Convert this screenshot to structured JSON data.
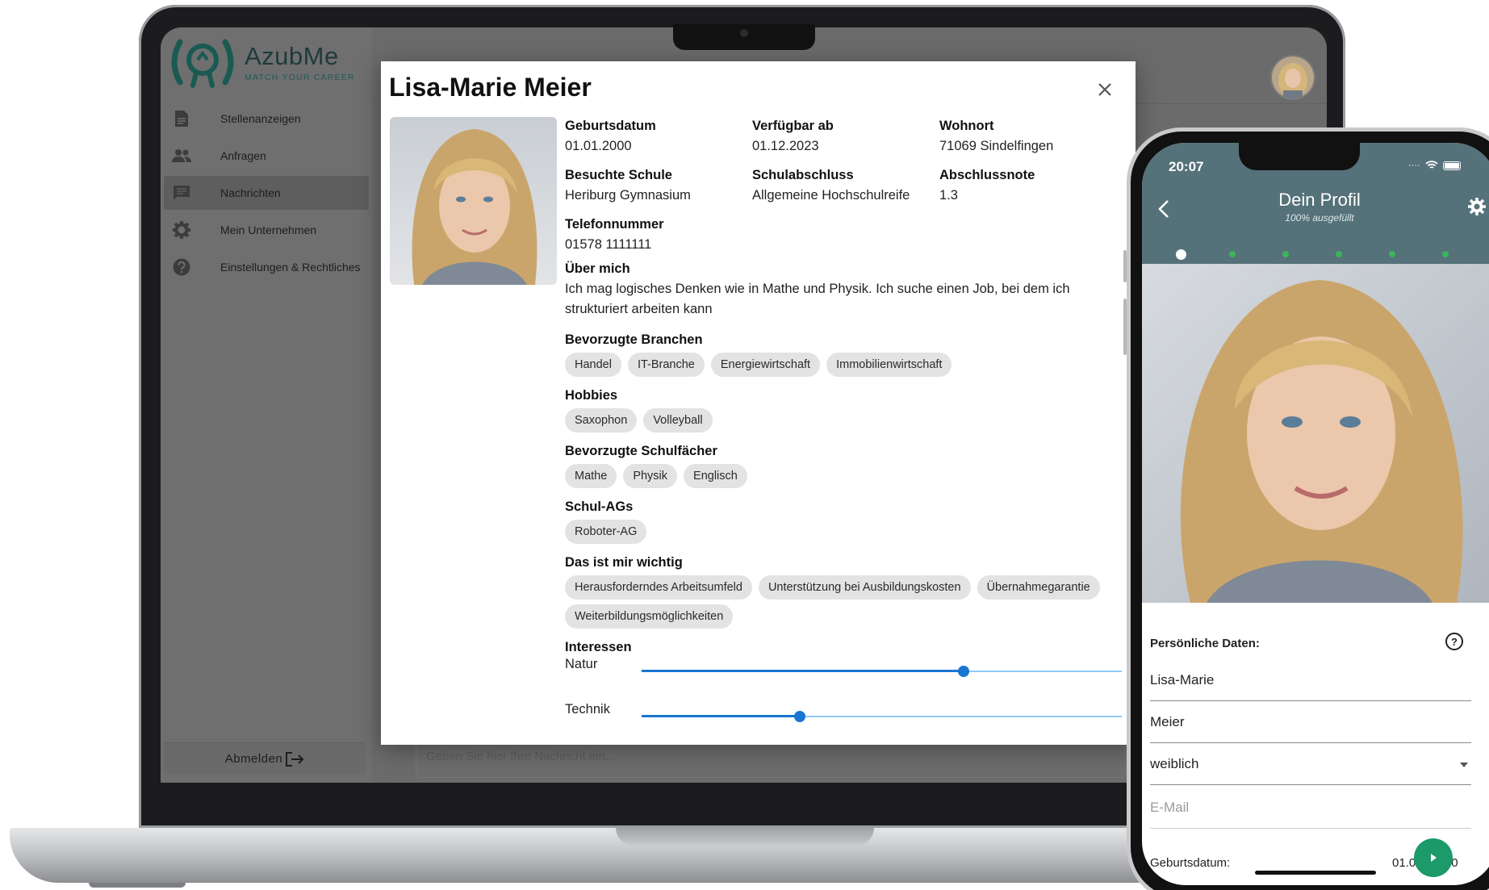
{
  "sidebar": {
    "logo_title": "AzubMe",
    "logo_subtitle": "MATCH YOUR CAREER",
    "items": [
      {
        "label": "Stellenanzeigen",
        "icon": "document-icon"
      },
      {
        "label": "Anfragen",
        "icon": "people-icon"
      },
      {
        "label": "Nachrichten",
        "icon": "chat-icon",
        "active": true
      },
      {
        "label": "Mein Unternehmen",
        "icon": "gear-icon"
      },
      {
        "label": "Einstellungen & Rechtliches",
        "icon": "help-icon"
      }
    ],
    "logout_label": "Abmelden"
  },
  "main": {
    "message_placeholder": "Geben Sie hier Ihre Nachricht ein..."
  },
  "modal": {
    "title": "Lisa-Marie Meier",
    "fields": [
      {
        "label": "Geburtsdatum",
        "value": "01.01.2000"
      },
      {
        "label": "Verfügbar ab",
        "value": "01.12.2023"
      },
      {
        "label": "Wohnort",
        "value": "71069 Sindelfingen"
      },
      {
        "label": "Besuchte Schule",
        "value": "Heriburg Gymnasium"
      },
      {
        "label": "Schulabschluss",
        "value": "Allgemeine Hochschulreife"
      },
      {
        "label": "Abschlussnote",
        "value": "1.3"
      },
      {
        "label": "Telefonnummer",
        "value": "01578 1111111"
      }
    ],
    "about": {
      "label": "Über mich",
      "text": "Ich mag logisches Denken wie in Mathe und Physik. Ich suche einen Job, bei dem ich strukturiert arbeiten kann"
    },
    "branchen": {
      "label": "Bevorzugte Branchen",
      "chips": [
        "Handel",
        "IT-Branche",
        "Energiewirtschaft",
        "Immobilienwirtschaft"
      ]
    },
    "hobbies": {
      "label": "Hobbies",
      "chips": [
        "Saxophon",
        "Volleyball"
      ]
    },
    "faecher": {
      "label": "Bevorzugte Schulfächer",
      "chips": [
        "Mathe",
        "Physik",
        "Englisch"
      ]
    },
    "ags": {
      "label": "Schul-AGs",
      "chips": [
        "Roboter-AG"
      ]
    },
    "wichtig": {
      "label": "Das ist mir wichtig",
      "chips": [
        "Herausforderndes Arbeitsumfeld",
        "Unterstützung bei Ausbildungskosten",
        "Übernahmegarantie",
        "Weiterbildungsmöglichkeiten"
      ]
    },
    "interessen": {
      "label": "Interessen",
      "items": [
        {
          "name": "Natur",
          "level": 0.67
        },
        {
          "name": "Technik",
          "level": 0.33
        }
      ]
    }
  },
  "phone": {
    "time": "20:07",
    "title": "Dein Profil",
    "subtitle": "100% ausgefüllt",
    "section": "Persönliche Daten:",
    "help": "?",
    "first_name": "Lisa-Marie",
    "last_name": "Meier",
    "gender": "weiblich",
    "email_placeholder": "E-Mail",
    "birthdate_label": "Geburtsdatum:",
    "birthdate_value": "01.0",
    "birthdate_value_tail": "0"
  },
  "colors": {
    "brand_teal": "#1f5a55",
    "phone_header": "#557179",
    "progress_green": "#3ab55a",
    "slider_blue": "#1976d2",
    "chip_bg": "#e3e3e3"
  }
}
